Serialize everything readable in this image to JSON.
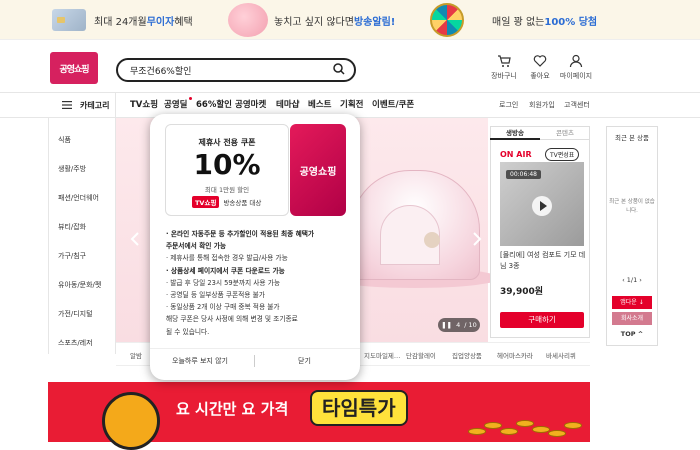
{
  "promo": {
    "card_prefix": "최대 24개월 ",
    "card_bold": "무이자",
    "card_suffix": "혜택",
    "alert_prefix": "놓치고 싶지 않다면 ",
    "alert_bold": "방송알림!",
    "wheel_prefix": "매일 꽝 없는 ",
    "wheel_bold": "100% 당첨"
  },
  "logo": "공영쇼핑",
  "search": {
    "value": "무조건66%할인"
  },
  "util": {
    "cart": "장바구니",
    "like": "좋아요",
    "mypage": "마이페이지"
  },
  "gnb": {
    "category": "카테고리",
    "items": [
      "TV쇼핑",
      "공영딜",
      "66%할인",
      "공영마켓",
      "테마샵",
      "베스트",
      "기획전",
      "이벤트/쿠폰"
    ],
    "util": [
      "로그인",
      "회원가입",
      "고객센터"
    ]
  },
  "categories": [
    "식품",
    "생활/주방",
    "패션/언더웨어",
    "뷰티/잡화",
    "가구/침구",
    "유아동/문화/펫",
    "가전/디지털",
    "스포츠/레저"
  ],
  "hero": {
    "pager_current": "4",
    "pager_total": "/ 10"
  },
  "subnav": [
    "알밤",
    "지도마일제…",
    "단감할레이",
    "집업양상품",
    "헤어마스카라",
    "바세사리퀴"
  ],
  "live": {
    "tabs": [
      "생방송",
      "콘텐츠"
    ],
    "onair": "ON AIR",
    "badge": "TV편성표",
    "time": "00:06:48",
    "product": "[몰리에] 여성 컴포트 기모 데님 3종",
    "price": "39,900원",
    "buy": "구매하기"
  },
  "recent": {
    "title": "최근 본 상품",
    "empty": "최근 본 상품이 없습니다.",
    "pager": "1/1",
    "btn1": "앱다운 ↓",
    "btn2": "회사소개",
    "top": "TOP ^"
  },
  "banner": {
    "text": "요 시간만 요 가격",
    "badge": "타임특가"
  },
  "popup": {
    "coupon_title": "제휴사 전용 쿠폰",
    "coupon_pct": "10%",
    "coupon_max": "최대 1만원 할인",
    "coupon_tv": "TV쇼핑",
    "coupon_target": "방송상품 대상",
    "logo": "공영쇼핑",
    "notes": [
      {
        "text": "· 온라인 자동주문 등 추가할인이 적용된 최종 혜택가",
        "bold": true
      },
      {
        "text": "  주문서에서 확인 가능",
        "bold": true
      },
      {
        "text": "· 제휴사를 통해 접속한 경우 발급/사용 가능",
        "bold": false
      },
      {
        "text": "· 상품상세 페이지에서 쿠폰 다운로드 가능",
        "bold": true
      },
      {
        "text": "· 발급 후 당일 23시 59분까지 사용 가능",
        "bold": false
      },
      {
        "text": "· 공영딜 등 일부상품 쿠폰적용 불가",
        "bold": false
      },
      {
        "text": "· 동일상품 2개 이상 구매 중복 적용 불가",
        "bold": false
      },
      {
        "text": "  해당 쿠폰은 당사 사정에 의해 변경 및 조기종료",
        "bold": false
      },
      {
        "text": "  될 수 있습니다.",
        "bold": false
      }
    ],
    "dismiss_today": "오늘하루 보지 않기",
    "close": "닫기"
  }
}
